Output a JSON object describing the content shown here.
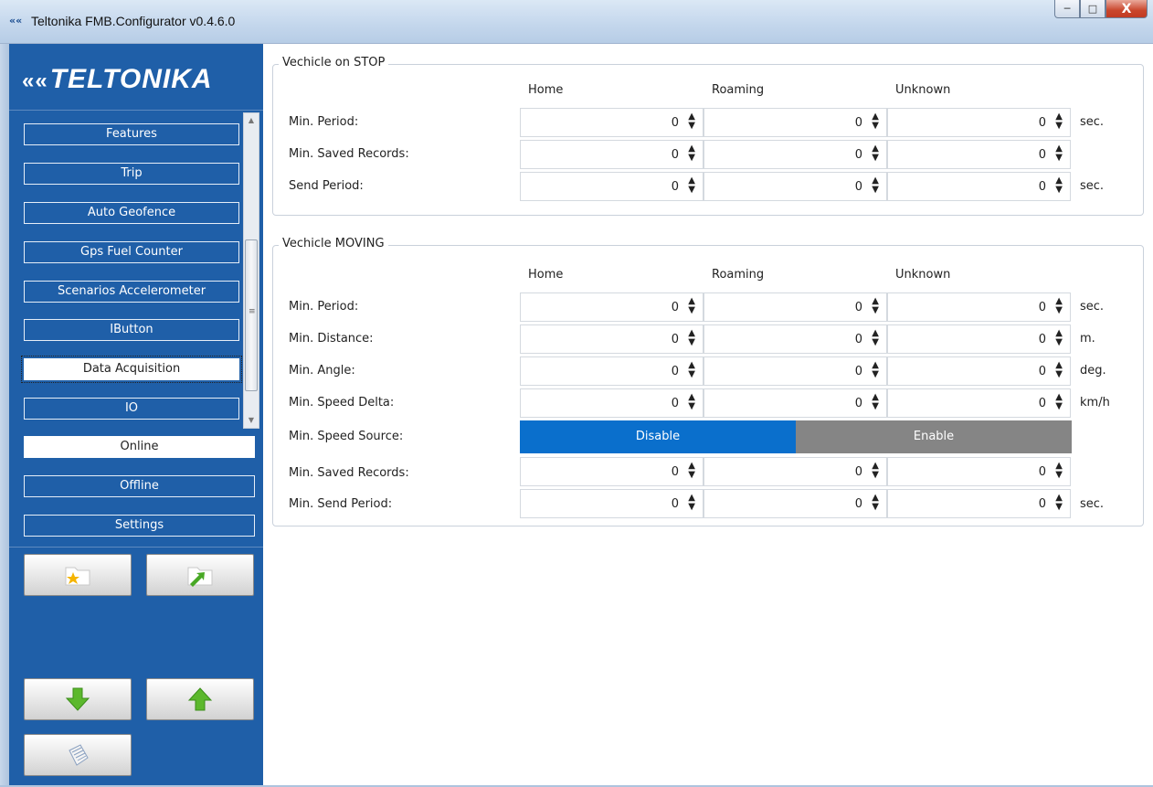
{
  "window": {
    "title": "Teltonika FMB.Configurator v0.4.6.0",
    "minimize": "─",
    "maximize": "□",
    "close": "X"
  },
  "sidebar": {
    "logo": "TELTONIKA",
    "items": [
      {
        "label": "Features"
      },
      {
        "label": "Trip"
      },
      {
        "label": "Auto Geofence"
      },
      {
        "label": "Gps Fuel Counter"
      },
      {
        "label": "Scenarios Accelerometer"
      },
      {
        "label": "IButton"
      },
      {
        "label": "Data Acquisition"
      },
      {
        "label": "IO"
      },
      {
        "label": "Online"
      },
      {
        "label": "Offline"
      },
      {
        "label": "Settings"
      }
    ],
    "tools": {
      "open_icon": "folder-star-icon",
      "save_icon": "folder-arrow-icon",
      "load_icon": "arrow-down-icon",
      "upload_icon": "arrow-up-icon",
      "notes_icon": "notepad-icon"
    }
  },
  "stop": {
    "legend": "Vechicle on STOP",
    "columns": [
      "Home",
      "Roaming",
      "Unknown"
    ],
    "rows": [
      {
        "label": "Min. Period:",
        "values": [
          "0",
          "0",
          "0"
        ],
        "unit": "sec."
      },
      {
        "label": "Min. Saved Records:",
        "values": [
          "0",
          "0",
          "0"
        ],
        "unit": ""
      },
      {
        "label": "Send Period:",
        "values": [
          "0",
          "0",
          "0"
        ],
        "unit": "sec."
      }
    ]
  },
  "moving": {
    "legend": "Vechicle MOVING",
    "columns": [
      "Home",
      "Roaming",
      "Unknown"
    ],
    "rows": [
      {
        "label": "Min. Period:",
        "values": [
          "0",
          "0",
          "0"
        ],
        "unit": "sec."
      },
      {
        "label": "Min. Distance:",
        "values": [
          "0",
          "0",
          "0"
        ],
        "unit": "m."
      },
      {
        "label": "Min. Angle:",
        "values": [
          "0",
          "0",
          "0"
        ],
        "unit": "deg."
      },
      {
        "label": "Min. Speed Delta:",
        "values": [
          "0",
          "0",
          "0"
        ],
        "unit": "km/h"
      }
    ],
    "speed_source": {
      "label": "Min. Speed Source:",
      "disable": "Disable",
      "enable": "Enable",
      "selected": "Disable"
    },
    "rows2": [
      {
        "label": "Min. Saved Records:",
        "values": [
          "0",
          "0",
          "0"
        ],
        "unit": ""
      },
      {
        "label": "Min. Send Period:",
        "values": [
          "0",
          "0",
          "0"
        ],
        "unit": "sec."
      }
    ]
  },
  "colors": {
    "sidebar": "#1f5fa8",
    "disable_bg": "#0a6fcc",
    "enable_bg": "#858585"
  }
}
